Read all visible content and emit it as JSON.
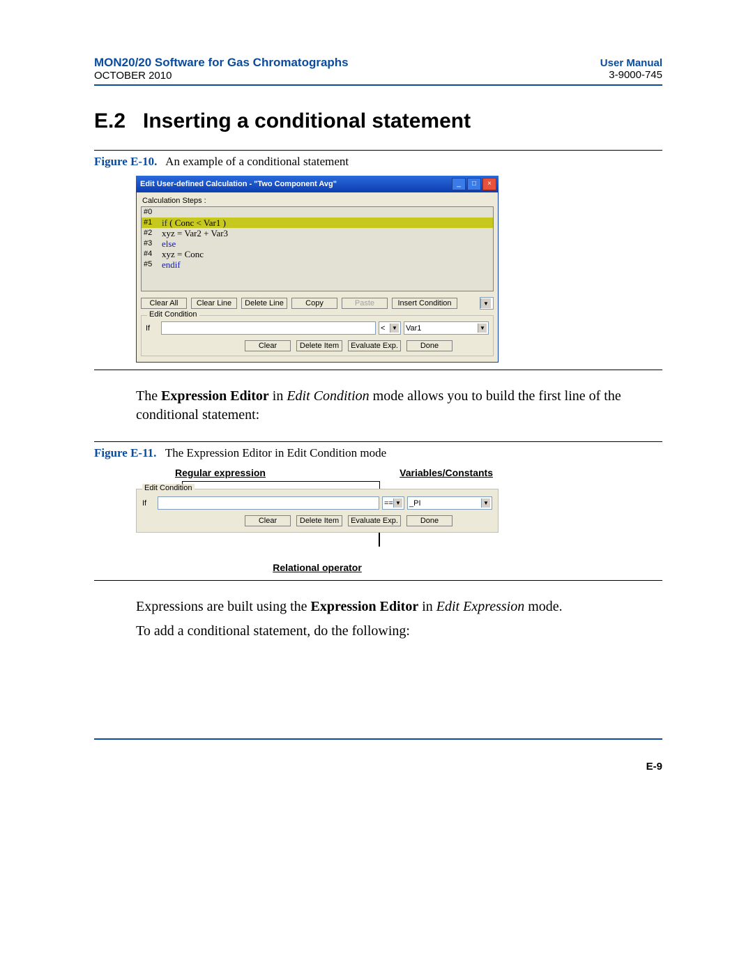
{
  "header": {
    "product": "MON20/20 Software for Gas Chromatographs",
    "date": "OCTOBER 2010",
    "manual": "User Manual",
    "docnum": "3-9000-745"
  },
  "section": {
    "num": "E.2",
    "title": "Inserting a conditional statement"
  },
  "fig10": {
    "label": "Figure E-10.",
    "caption": "An example of a conditional statement"
  },
  "shot1": {
    "title": "Edit User-defined Calculation - \"Two Component Avg\"",
    "steps_label": "Calculation Steps :",
    "rows": [
      {
        "n": "#0",
        "code": ""
      },
      {
        "n": "#1",
        "code_kw": "if",
        "code_rest": " ( Conc < Var1 )"
      },
      {
        "n": "#2",
        "code": "      xyz = Var2 + Var3"
      },
      {
        "n": "#3",
        "code_kw": "else",
        "code_rest": ""
      },
      {
        "n": "#4",
        "code": "      xyz = Conc"
      },
      {
        "n": "#5",
        "code_kw": "endif",
        "code_rest": ""
      }
    ],
    "btns": {
      "clear_all": "Clear All",
      "clear_line": "Clear Line",
      "delete_line": "Delete Line",
      "copy": "Copy",
      "paste": "Paste",
      "insert_cond": "Insert Condition"
    },
    "group": "Edit Condition",
    "if": "If",
    "op": "<",
    "var": "Var1",
    "lower": {
      "clear": "Clear",
      "delete_item": "Delete Item",
      "evaluate": "Evaluate Exp.",
      "done": "Done"
    }
  },
  "para1_a": "The ",
  "para1_b": "Expression Editor",
  "para1_c": " in ",
  "para1_d": "Edit Condition",
  "para1_e": " mode allows you to build the first line of the conditional statement:",
  "fig11": {
    "label": "Figure E-11.",
    "caption": "The Expression Editor in Edit Condition mode"
  },
  "ann": {
    "regex": "Regular expression",
    "vars": "Variables/Constants",
    "relop": "Relational operator"
  },
  "shot2": {
    "group": "Edit Condition",
    "if": "If",
    "op": "==",
    "var": "_PI",
    "lower": {
      "clear": "Clear",
      "delete_item": "Delete Item",
      "evaluate": "Evaluate Exp.",
      "done": "Done"
    }
  },
  "para2_a": "Expressions are built using the ",
  "para2_b": "Expression Editor",
  "para2_c": " in ",
  "para2_d": "Edit Expression",
  "para2_e": " mode.",
  "para3": "To add a conditional statement, do the following:",
  "pagenum": "E-9"
}
